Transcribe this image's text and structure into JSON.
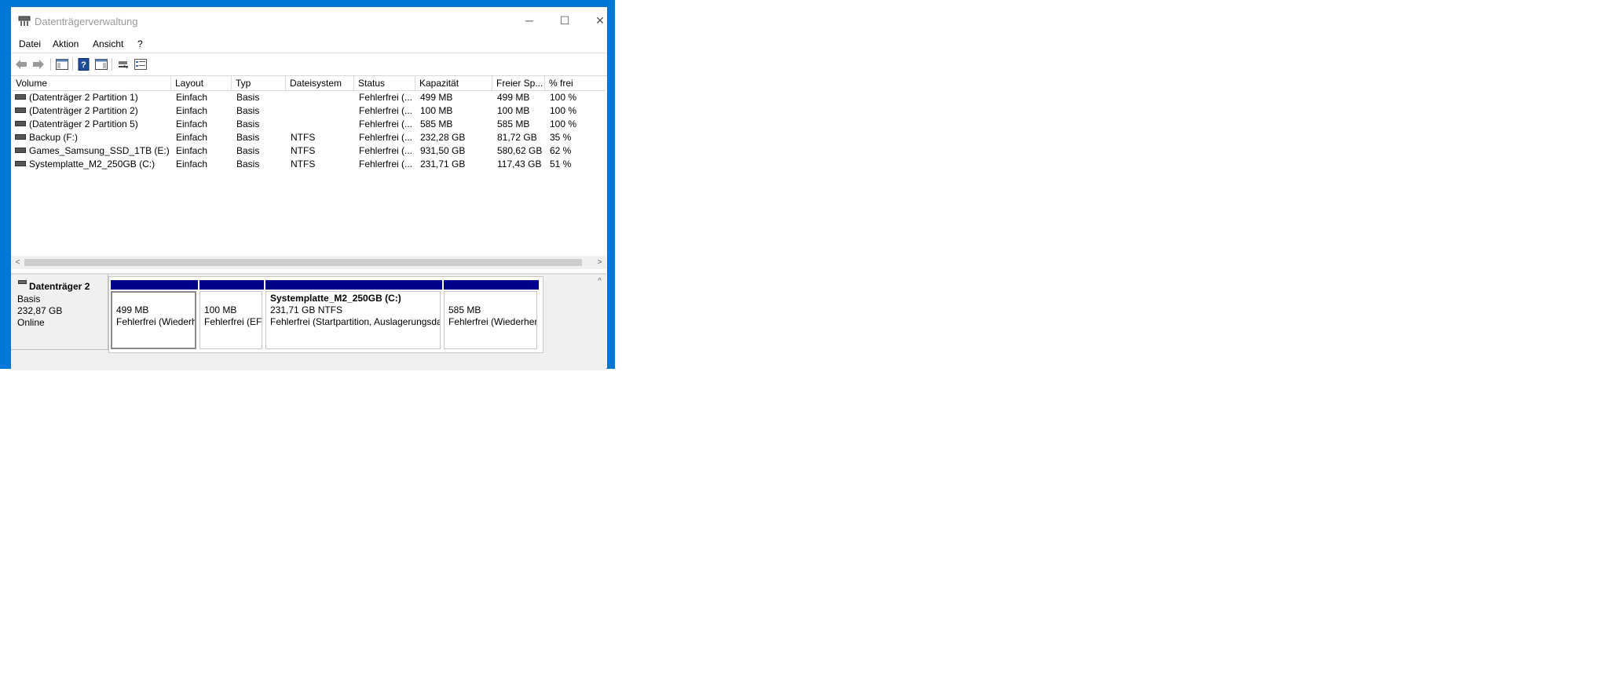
{
  "window": {
    "title": "Datenträgerverwaltung",
    "minimize_glyph": "─",
    "maximize_glyph": "☐",
    "close_glyph": "✕"
  },
  "menu": [
    {
      "label": "Datei"
    },
    {
      "label": "Aktion"
    },
    {
      "label": "Ansicht"
    },
    {
      "label": "?"
    }
  ],
  "toolbar": {
    "icons": [
      "back-icon",
      "forward-icon",
      "show-hide-console-tree-icon",
      "help-icon",
      "show-hide-action-pane-icon",
      "connect-icon",
      "properties-icon"
    ]
  },
  "volume_list": {
    "columns": [
      "Volume",
      "Layout",
      "Typ",
      "Dateisystem",
      "Status",
      "Kapazität",
      "Freier Sp...",
      "% frei"
    ],
    "rows": [
      {
        "volume": "(Datenträger 2 Partition 1)",
        "layout": "Einfach",
        "typ": "Basis",
        "fs": "",
        "status": "Fehlerfrei (...",
        "capacity": "499 MB",
        "free": "499 MB",
        "pct": "100 %"
      },
      {
        "volume": "(Datenträger 2 Partition 2)",
        "layout": "Einfach",
        "typ": "Basis",
        "fs": "",
        "status": "Fehlerfrei (...",
        "capacity": "100 MB",
        "free": "100 MB",
        "pct": "100 %"
      },
      {
        "volume": "(Datenträger 2 Partition 5)",
        "layout": "Einfach",
        "typ": "Basis",
        "fs": "",
        "status": "Fehlerfrei (...",
        "capacity": "585 MB",
        "free": "585 MB",
        "pct": "100 %"
      },
      {
        "volume": "Backup (F:)",
        "layout": "Einfach",
        "typ": "Basis",
        "fs": "NTFS",
        "status": "Fehlerfrei (...",
        "capacity": "232,28 GB",
        "free": "81,72 GB",
        "pct": "35 %"
      },
      {
        "volume": "Games_Samsung_SSD_1TB (E:)",
        "layout": "Einfach",
        "typ": "Basis",
        "fs": "NTFS",
        "status": "Fehlerfrei (...",
        "capacity": "931,50 GB",
        "free": "580,62 GB",
        "pct": "62 %"
      },
      {
        "volume": "Systemplatte_M2_250GB (C:)",
        "layout": "Einfach",
        "typ": "Basis",
        "fs": "NTFS",
        "status": "Fehlerfrei (...",
        "capacity": "231,71 GB",
        "free": "117,43 GB",
        "pct": "51 %"
      }
    ],
    "scroll_left": "<",
    "scroll_right": ">"
  },
  "disk": {
    "name": "Datenträger 2",
    "type": "Basis",
    "size": "232,87 GB",
    "state": "Online",
    "partitions": [
      {
        "title": "",
        "line1": "499 MB",
        "line2": "Fehlerfrei (Wiederherstellungspartition)"
      },
      {
        "title": "",
        "line1": "100 MB",
        "line2": "Fehlerfrei (EFI-Systempartition)"
      },
      {
        "title": "Systemplatte_M2_250GB  (C:)",
        "line1": "231,71 GB NTFS",
        "line2": "Fehlerfrei (Startpartition, Auslagerungsdatei, Absturzabbild, Primäre Partition)"
      },
      {
        "title": "",
        "line1": "585 MB",
        "line2": "Fehlerfrei (Wiederherstellungspartition)"
      }
    ],
    "scroll_up": "^"
  }
}
